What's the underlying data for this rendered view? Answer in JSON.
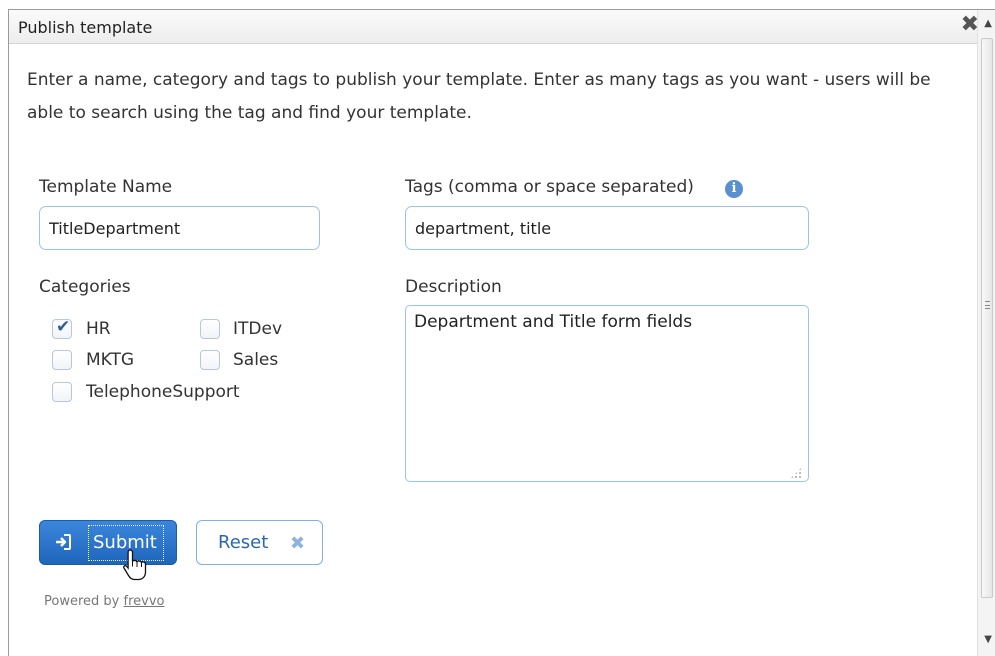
{
  "dialog": {
    "title": "Publish template",
    "close_icon": "close-icon"
  },
  "intro": "Enter a name, category and tags to publish your template. Enter as many tags as you want - users will be able to search using the tag and find your template.",
  "form": {
    "template_name_label": "Template Name",
    "template_name_value": "TitleDepartment",
    "tags_label": "Tags (comma or space separated)",
    "tags_value": "department, title",
    "info_icon": "info-icon",
    "categories_label": "Categories",
    "categories": [
      {
        "label": "HR",
        "checked": true
      },
      {
        "label": "ITDev",
        "checked": false
      },
      {
        "label": "MKTG",
        "checked": false
      },
      {
        "label": "Sales",
        "checked": false
      },
      {
        "label": "TelephoneSupport",
        "checked": false
      }
    ],
    "description_label": "Description",
    "description_value": "Department and Title form fields"
  },
  "buttons": {
    "submit_label": "Submit",
    "reset_label": "Reset"
  },
  "footer": {
    "powered_text": "Powered by",
    "powered_link": "frevvo"
  },
  "colors": {
    "accent": "#2a76d2",
    "field_border": "#9dc3ea"
  }
}
